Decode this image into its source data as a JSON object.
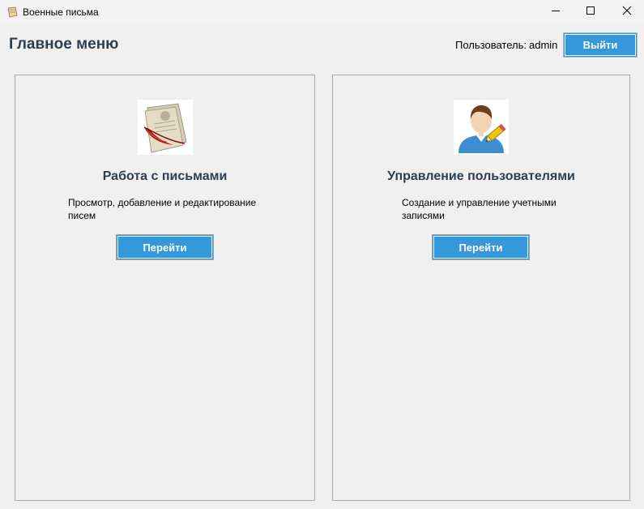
{
  "window": {
    "title": "Военные письма",
    "app_icon": "scroll-icon",
    "controls": {
      "minimize": "minimize-icon",
      "maximize": "maximize-icon",
      "close": "close-icon"
    }
  },
  "header": {
    "title": "Главное меню",
    "user_label": "Пользователь:",
    "user_name": "admin",
    "logout_label": "Выйти"
  },
  "cards": [
    {
      "icon": "letters-quill-icon",
      "title": "Работа с письмами",
      "description": "Просмотр, добавление и редактирование писем",
      "button_label": "Перейти"
    },
    {
      "icon": "user-edit-icon",
      "title": "Управление пользователями",
      "description": "Создание и управление учетными записями",
      "button_label": "Перейти"
    }
  ],
  "colors": {
    "accent": "#3498db",
    "heading": "#2c3e50",
    "background": "#f0f0f0"
  }
}
